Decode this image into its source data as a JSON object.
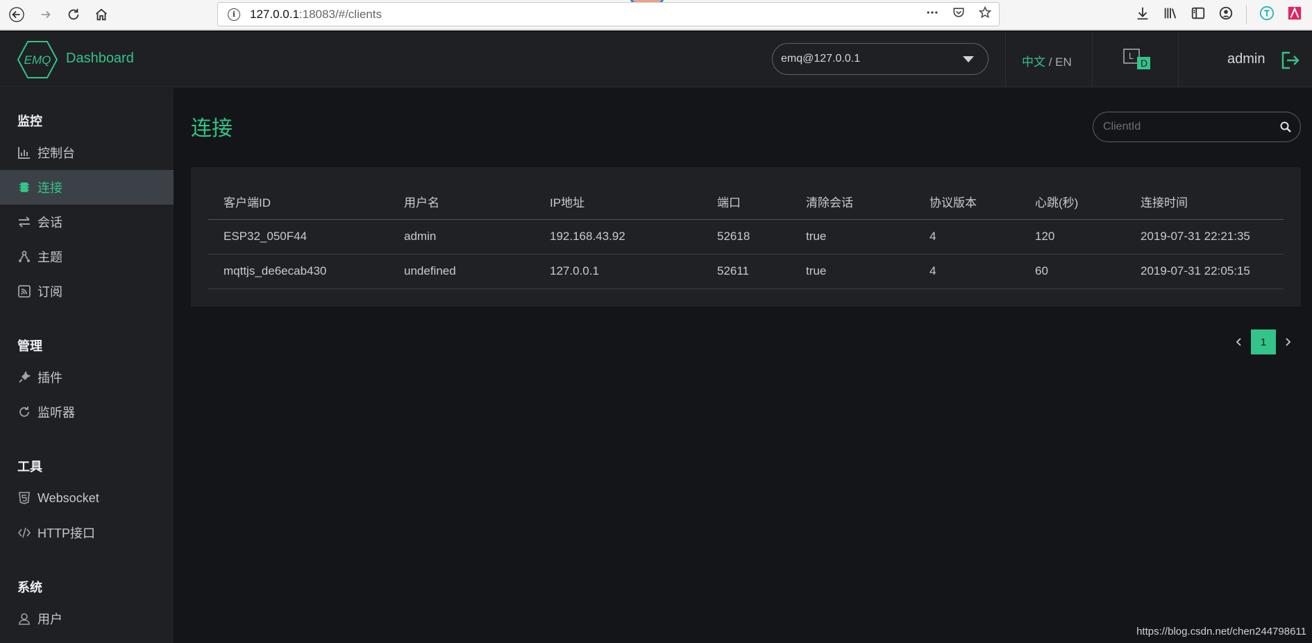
{
  "browser": {
    "url_host": "127.0.0.1",
    "url_path": ":18083/#/clients"
  },
  "header": {
    "logo_text": "EMQ",
    "app_name": "Dashboard",
    "node": "emq@127.0.0.1",
    "lang_zh": "中文",
    "lang_sep": " / ",
    "lang_en": "EN",
    "theme_light": "L",
    "theme_dark": "D",
    "user": "admin"
  },
  "sidebar": {
    "groups": [
      {
        "title": "监控",
        "items": [
          {
            "label": "控制台",
            "icon": "bar-chart-icon"
          },
          {
            "label": "连接",
            "icon": "chip-icon",
            "active": true
          },
          {
            "label": "会话",
            "icon": "exchange-icon"
          },
          {
            "label": "主题",
            "icon": "share-icon"
          },
          {
            "label": "订阅",
            "icon": "rss-icon"
          }
        ]
      },
      {
        "title": "管理",
        "items": [
          {
            "label": "插件",
            "icon": "plug-icon"
          },
          {
            "label": "监听器",
            "icon": "refresh-icon"
          }
        ]
      },
      {
        "title": "工具",
        "items": [
          {
            "label": "Websocket",
            "icon": "html5-icon"
          },
          {
            "label": "HTTP接口",
            "icon": "code-icon"
          }
        ]
      },
      {
        "title": "系统",
        "items": [
          {
            "label": "用户",
            "icon": "user-icon"
          }
        ]
      }
    ]
  },
  "main": {
    "title": "连接",
    "search_placeholder": "ClientId",
    "columns": [
      "客户端ID",
      "用户名",
      "IP地址",
      "端口",
      "清除会话",
      "协议版本",
      "心跳(秒)",
      "连接时间"
    ],
    "rows": [
      [
        "ESP32_050F44",
        "admin",
        "192.168.43.92",
        "52618",
        "true",
        "4",
        "120",
        "2019-07-31 22:21:35"
      ],
      [
        "mqttjs_de6ecab430",
        "undefined",
        "127.0.0.1",
        "52611",
        "true",
        "4",
        "60",
        "2019-07-31 22:05:15"
      ]
    ],
    "current_page": "1"
  },
  "watermark": "https://blog.csdn.net/chen244798611",
  "colors": {
    "accent": "#34c388",
    "bg": "#141519",
    "panel": "#202125",
    "sidebar": "#1f2024"
  }
}
